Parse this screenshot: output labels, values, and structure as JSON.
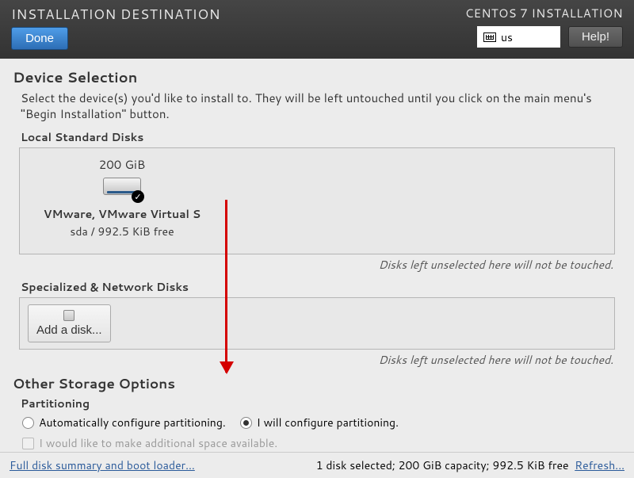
{
  "header": {
    "title": "INSTALLATION DESTINATION",
    "done": "Done",
    "subtitle": "CENTOS 7 INSTALLATION",
    "kb": "us",
    "help": "Help!"
  },
  "main": {
    "device_selection": "Device Selection",
    "device_desc": "Select the device(s) you'd like to install to.  They will be left untouched until you click on the main menu's \"Begin Installation\" button.",
    "local_disks": "Local Standard Disks",
    "disk": {
      "size": "200 GiB",
      "name": "VMware, VMware Virtual S",
      "detail": "sda   /    992.5 KiB free"
    },
    "hint": "Disks left unselected here will not be touched.",
    "special_disks": "Specialized & Network Disks",
    "add_disk": "Add a disk...",
    "other_storage": "Other Storage Options",
    "partitioning": "Partitioning",
    "auto_part": "Automatically configure partitioning.",
    "manual_part": "I will configure partitioning.",
    "make_space": "I would like to make additional space available."
  },
  "footer": {
    "summary_link": "Full disk summary and boot loader...",
    "status": "1 disk selected; 200 GiB capacity; 992.5 KiB free",
    "refresh": "Refresh..."
  }
}
